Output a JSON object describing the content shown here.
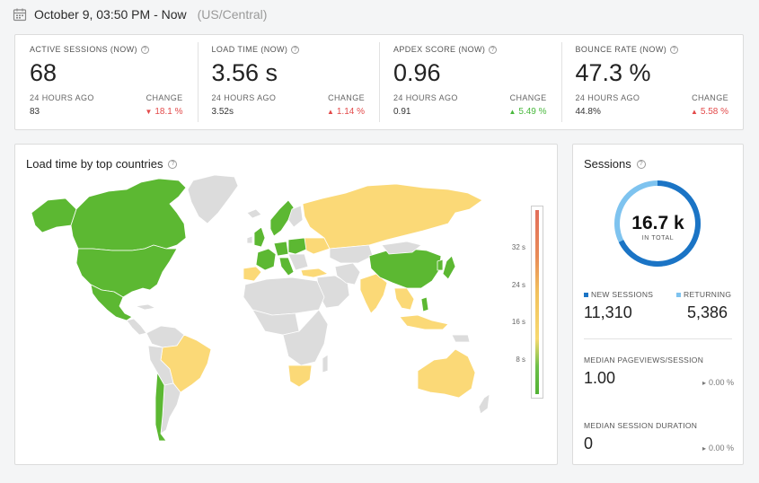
{
  "header": {
    "time_range": "October 9, 03:50 PM - Now",
    "timezone": "(US/Central)"
  },
  "kpis": [
    {
      "title": "ACTIVE SESSIONS (NOW)",
      "value": "68",
      "prev_label": "24 HOURS AGO",
      "change_label": "CHANGE",
      "prev_value": "83",
      "change": "18.1 %",
      "direction": "down",
      "status": "bad"
    },
    {
      "title": "LOAD TIME (NOW)",
      "value": "3.56 s",
      "prev_label": "24 HOURS AGO",
      "change_label": "CHANGE",
      "prev_value": "3.52s",
      "change": "1.14 %",
      "direction": "up",
      "status": "bad"
    },
    {
      "title": "APDEX SCORE (NOW)",
      "value": "0.96",
      "prev_label": "24 HOURS AGO",
      "change_label": "CHANGE",
      "prev_value": "0.91",
      "change": "5.49 %",
      "direction": "up",
      "status": "good"
    },
    {
      "title": "BOUNCE RATE (NOW)",
      "value": "47.3 %",
      "prev_label": "24 HOURS AGO",
      "change_label": "CHANGE",
      "prev_value": "44.8%",
      "change": "5.58 %",
      "direction": "up",
      "status": "bad"
    }
  ],
  "map": {
    "title": "Load time by top countries",
    "scale_labels": [
      "32 s",
      "24 s",
      "16 s",
      "8 s"
    ],
    "colors": {
      "fast": "#5cb832",
      "medium": "#fbd977",
      "none": "#dcdcdc"
    }
  },
  "sessions": {
    "title": "Sessions",
    "total": "16.7 k",
    "total_label": "IN TOTAL",
    "new_fraction": 0.677,
    "new_label": "NEW SESSIONS",
    "new_value": "11,310",
    "returning_label": "RETURNING",
    "returning_value": "5,386",
    "pageviews_label": "MEDIAN PAGEVIEWS/SESSION",
    "pageviews_value": "1.00",
    "pageviews_change": "0.00 %",
    "duration_label": "MEDIAN SESSION DURATION",
    "duration_value": "0",
    "duration_change": "0.00 %",
    "colors": {
      "new": "#1b74c5",
      "returning": "#7ec3ef"
    }
  }
}
